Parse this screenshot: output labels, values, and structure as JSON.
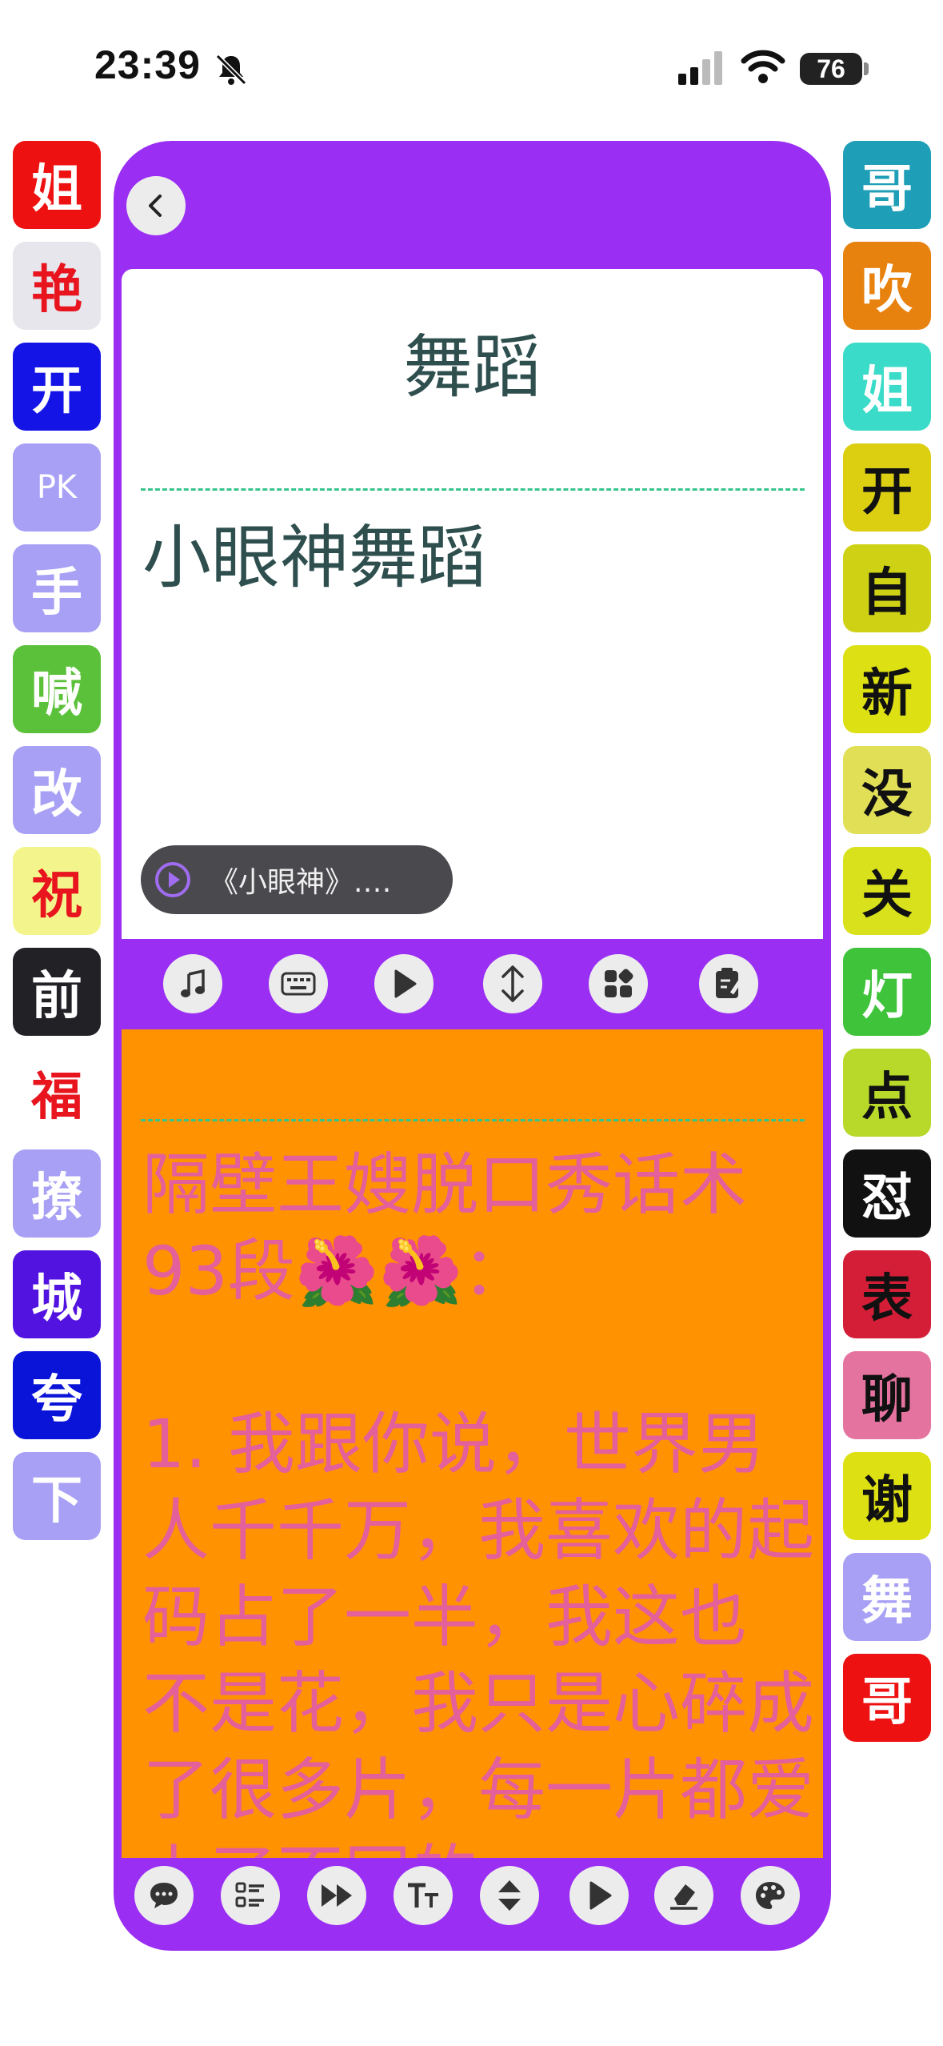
{
  "status_bar": {
    "time": "23:39",
    "battery": "76"
  },
  "left_tiles": [
    {
      "label": "姐",
      "bg": "#ee1111",
      "fg": "#ffffff"
    },
    {
      "label": "艳",
      "bg": "#e6e6ec",
      "fg": "#e8141e"
    },
    {
      "label": "开",
      "bg": "#1414e6",
      "fg": "#ffffff"
    },
    {
      "label": "PK",
      "bg": "#a7a0f5",
      "fg": "#ffffff",
      "small": true
    },
    {
      "label": "手",
      "bg": "#a7a0f5",
      "fg": "#ffffff"
    },
    {
      "label": "喊",
      "bg": "#5cc13a",
      "fg": "#ffffff"
    },
    {
      "label": "改",
      "bg": "#a7a0f5",
      "fg": "#ffffff"
    },
    {
      "label": "祝",
      "bg": "#f3f58c",
      "fg": "#e8141e"
    },
    {
      "label": "前",
      "bg": "#222226",
      "fg": "#ffffff"
    },
    {
      "label": "福",
      "bg": "#ffffff",
      "fg": "#e8141e"
    },
    {
      "label": "撩",
      "bg": "#a7a0f5",
      "fg": "#ffffff"
    },
    {
      "label": "城",
      "bg": "#5212e0",
      "fg": "#ffffff"
    },
    {
      "label": "夸",
      "bg": "#0a14d8",
      "fg": "#ffffff"
    },
    {
      "label": "下",
      "bg": "#a7a0f5",
      "fg": "#ffffff"
    }
  ],
  "right_tiles": [
    {
      "label": "哥",
      "bg": "#1f9fb7",
      "fg": "#ffffff"
    },
    {
      "label": "吹",
      "bg": "#e8820e",
      "fg": "#ffffff"
    },
    {
      "label": "姐",
      "bg": "#3adbc8",
      "fg": "#ffffff"
    },
    {
      "label": "开",
      "bg": "#dccf12",
      "fg": "#111111"
    },
    {
      "label": "自",
      "bg": "#cfd214",
      "fg": "#111111"
    },
    {
      "label": "新",
      "bg": "#dde013",
      "fg": "#111111"
    },
    {
      "label": "没",
      "bg": "#e1df56",
      "fg": "#111111"
    },
    {
      "label": "关",
      "bg": "#d8e11c",
      "fg": "#111111"
    },
    {
      "label": "灯",
      "bg": "#3ec33a",
      "fg": "#ffffff"
    },
    {
      "label": "点",
      "bg": "#b8d82a",
      "fg": "#111111"
    },
    {
      "label": "怼",
      "bg": "#111111",
      "fg": "#ffffff"
    },
    {
      "label": "表",
      "bg": "#d41e37",
      "fg": "#111111"
    },
    {
      "label": "聊",
      "bg": "#e5739f",
      "fg": "#111111"
    },
    {
      "label": "谢",
      "bg": "#dde013",
      "fg": "#111111"
    },
    {
      "label": "舞",
      "bg": "#a7a0f5",
      "fg": "#ffffff"
    },
    {
      "label": "哥",
      "bg": "#ee1111",
      "fg": "#ffffff"
    }
  ],
  "main": {
    "title": "舞蹈",
    "subtitle": "小眼神舞蹈",
    "music_label": "《小眼神》.…",
    "poem": "隔壁王嫂脱口秀话术93段🌺🌺：\n\n1. 我跟你说，世界男人千千万，我喜欢的起码占了一半，我这也 不是花，我只是心碎成了很多片，每一片都爱上了不同的"
  },
  "colors": {
    "panel": "#9a2ef3",
    "content_bg": "#ff9200",
    "poem_text": "#e4609a",
    "accent": "#39c48a"
  }
}
